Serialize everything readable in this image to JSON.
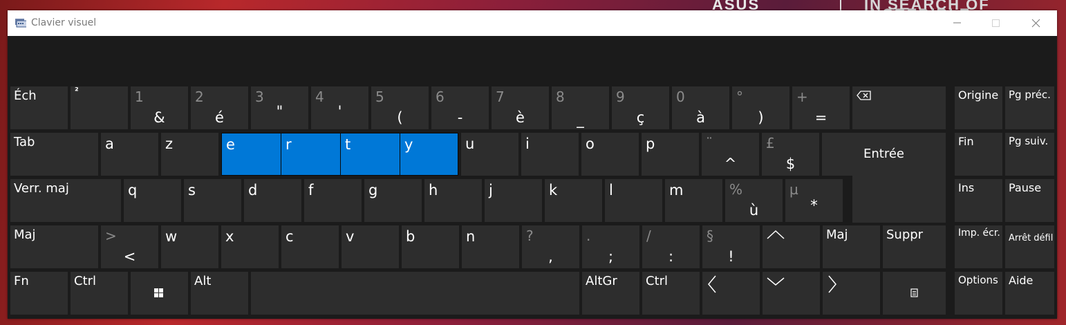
{
  "background": {
    "brand": "ASUS",
    "tagline": "IN SEARCH OF INCREDIBLE"
  },
  "window": {
    "title": "Clavier visuel",
    "icon": "keyboard-icon"
  },
  "row1": {
    "esc": "Éch",
    "sup2": "²",
    "keys": [
      [
        "1",
        "&"
      ],
      [
        "2",
        "é"
      ],
      [
        "3",
        "\""
      ],
      [
        "4",
        "'"
      ],
      [
        "5",
        "("
      ],
      [
        "6",
        "-"
      ],
      [
        "7",
        "è"
      ],
      [
        "8",
        "_"
      ],
      [
        "9",
        "ç"
      ],
      [
        "0",
        "à"
      ],
      [
        "°",
        ")"
      ],
      [
        "+",
        "="
      ]
    ],
    "backspace_icon": "backspace-icon"
  },
  "row2": {
    "tab": "Tab",
    "letters": [
      "a",
      "z",
      "e",
      "r",
      "t",
      "y",
      "u",
      "i",
      "o",
      "p"
    ],
    "caret_top": "¨",
    "caret_bot": "^",
    "pound_top": "£",
    "pound_bot": "$",
    "enter": "Entrée"
  },
  "row3": {
    "caps": "Verr. maj",
    "letters": [
      "q",
      "s",
      "d",
      "f",
      "g",
      "h",
      "j",
      "k",
      "l",
      "m"
    ],
    "pct_top": "%",
    "pct_bot": "ù",
    "mu_top": "µ",
    "mu_bot": "*"
  },
  "row4": {
    "shift_left": "Maj",
    "lt_top": ">",
    "lt_bot": "<",
    "letters": [
      "w",
      "x",
      "c",
      "v",
      "b",
      "n"
    ],
    "punct": [
      [
        "?",
        ","
      ],
      [
        ".",
        ";"
      ],
      [
        "/",
        ":"
      ],
      [
        "§",
        "!"
      ]
    ],
    "shift_right": "Maj",
    "delete": "Suppr"
  },
  "row5": {
    "fn": "Fn",
    "ctrl_left": "Ctrl",
    "alt": "Alt",
    "altgr": "AltGr",
    "ctrl_right": "Ctrl"
  },
  "nav": {
    "home": "Origine",
    "page_up": "Pg préc.",
    "end": "Fin",
    "page_down": "Pg suiv.",
    "insert": "Ins",
    "pause": "Pause",
    "print_screen": "Imp. écr.",
    "scroll_lock": "Arrêt défil",
    "options": "Options",
    "help": "Aide"
  },
  "highlighted_keys": [
    "e",
    "r",
    "t",
    "y"
  ],
  "colors": {
    "key": "#2d2d2d",
    "highlight": "#0078d7",
    "panel": "#1b1b1b",
    "secondary_text": "#8b8b8b"
  }
}
